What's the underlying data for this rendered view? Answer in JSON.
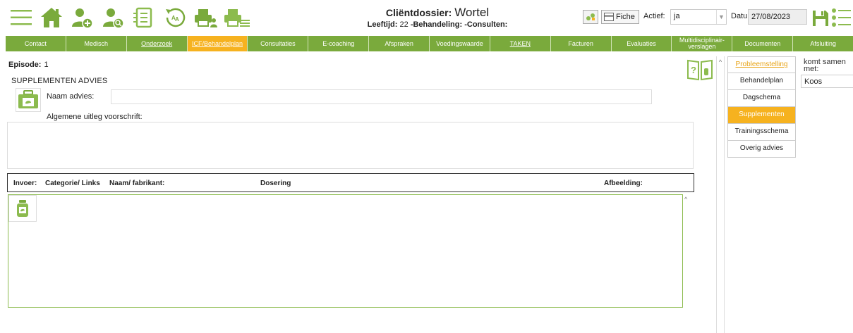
{
  "toolbar": {
    "icons": [
      "menu-icon",
      "home-icon",
      "add-client-icon",
      "search-client-icon",
      "document-list-icon",
      "history-icon",
      "print-client-icon",
      "print-list-icon"
    ]
  },
  "header": {
    "dossier_label": "Cliëntdossier:",
    "client_name": "Wortel",
    "age_label": "Leeftijd:",
    "age_value": "22",
    "behandeling": "-Behandeling:",
    "consulten": "-Consulten:"
  },
  "top_right": {
    "fiche_label": "Fiche",
    "actief_label": "Actief:",
    "actief_value": "ja",
    "datum_label": "Datum:",
    "datum_value": "27/08/2023"
  },
  "nav": {
    "items": [
      {
        "label": "Contact",
        "underline": false,
        "active": false
      },
      {
        "label": "Medisch",
        "underline": false,
        "active": false
      },
      {
        "label": "Onderzoek",
        "underline": true,
        "active": false
      },
      {
        "label": "ICF/Behandelplan",
        "underline": true,
        "active": true
      },
      {
        "label": "Consultaties",
        "underline": false,
        "active": false
      },
      {
        "label": "E-coaching",
        "underline": false,
        "active": false
      },
      {
        "label": "Afspraken",
        "underline": false,
        "active": false
      },
      {
        "label": "Voedingswaarde",
        "underline": false,
        "active": false
      },
      {
        "label": "TAKEN",
        "underline": true,
        "active": false
      },
      {
        "label": "Facturen",
        "underline": false,
        "active": false
      },
      {
        "label": "Evaluaties",
        "underline": false,
        "active": false
      },
      {
        "label": "Multidisciplinair-verslagen",
        "underline": false,
        "active": false
      },
      {
        "label": "Documenten",
        "underline": false,
        "active": false
      },
      {
        "label": "Afsluiting",
        "underline": false,
        "active": false
      }
    ]
  },
  "main": {
    "episode_label": "Episode:",
    "episode_value": "1",
    "section_title": "SUPPLEMENTEN ADVIES",
    "naam_label": "Naam advies:",
    "naam_value": "",
    "uitleg_label": "Algemene uitleg voorschrift:",
    "uitleg_value": ""
  },
  "table": {
    "columns": [
      "Invoer:",
      "Categorie/ Links",
      "Naam/ fabrikant:",
      "Dosering",
      "Afbeelding:"
    ]
  },
  "side_menu": {
    "items": [
      {
        "label": "Probleemstelling",
        "state": "link"
      },
      {
        "label": "Behandelplan",
        "state": "normal"
      },
      {
        "label": "Dagschema",
        "state": "normal"
      },
      {
        "label": "Supplementen",
        "state": "active"
      },
      {
        "label": "Trainingsschema",
        "state": "normal"
      },
      {
        "label": "Overig advies",
        "state": "normal"
      }
    ]
  },
  "komt_samen": {
    "label": "komt samen met:",
    "name": "Koos"
  },
  "colors": {
    "brand_green": "#7aaa3c",
    "accent_orange": "#f6b21f",
    "link_orange": "#e8a418"
  }
}
